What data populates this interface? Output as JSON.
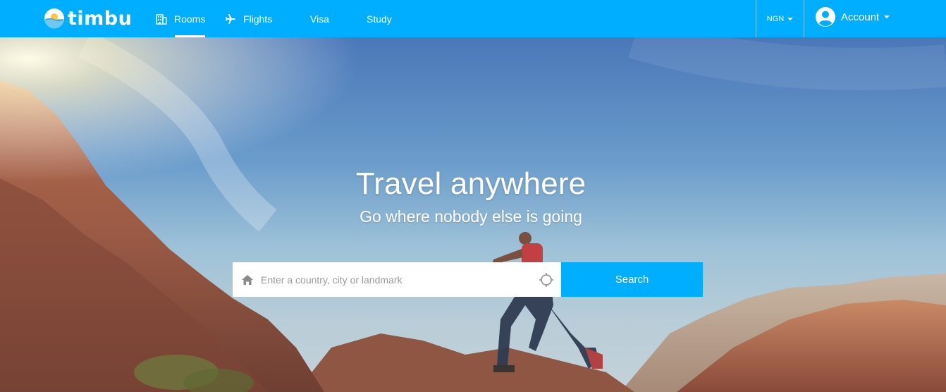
{
  "brand": {
    "name": "timbu",
    "logo_icon": "sun-horizon-logo-icon"
  },
  "nav": {
    "items": [
      {
        "label": "Rooms",
        "icon": "building-icon",
        "active": true
      },
      {
        "label": "Flights",
        "icon": "airplane-icon",
        "active": false
      },
      {
        "label": "Visa",
        "icon": "",
        "active": false
      },
      {
        "label": "Study",
        "icon": "",
        "active": false
      }
    ],
    "currency": "NGN",
    "account_label": "Account",
    "account_icon": "user-circle-icon"
  },
  "hero": {
    "title": "Travel anywhere",
    "subtitle": "Go where nobody else is going"
  },
  "search": {
    "placeholder": "Enter a country, city or landmark",
    "value": "",
    "button_label": "Search",
    "leading_icon": "home-icon",
    "trailing_icon": "crosshair-locate-icon"
  },
  "colors": {
    "primary": "#00aeff",
    "text_on_primary": "#ffffff"
  }
}
